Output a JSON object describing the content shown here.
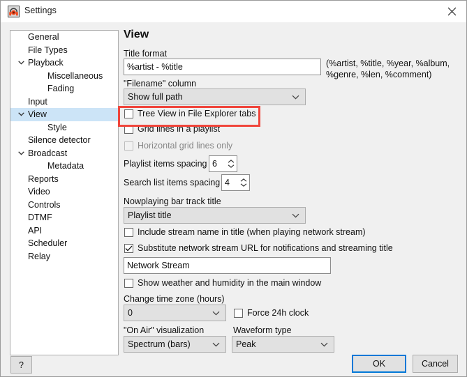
{
  "window": {
    "title": "Settings",
    "app_icon": "headphones-icon",
    "close_icon": "close-icon"
  },
  "sidebar": {
    "items": [
      {
        "label": "General",
        "level": 0,
        "chevron": false,
        "selected": false
      },
      {
        "label": "File Types",
        "level": 0,
        "chevron": false,
        "selected": false
      },
      {
        "label": "Playback",
        "level": 0,
        "chevron": true,
        "selected": false
      },
      {
        "label": "Miscellaneous",
        "level": 1,
        "chevron": false,
        "selected": false
      },
      {
        "label": "Fading",
        "level": 1,
        "chevron": false,
        "selected": false
      },
      {
        "label": "Input",
        "level": 0,
        "chevron": false,
        "selected": false
      },
      {
        "label": "View",
        "level": 0,
        "chevron": true,
        "selected": true
      },
      {
        "label": "Style",
        "level": 1,
        "chevron": false,
        "selected": false
      },
      {
        "label": "Silence detector",
        "level": 0,
        "chevron": false,
        "selected": false
      },
      {
        "label": "Broadcast",
        "level": 0,
        "chevron": true,
        "selected": false
      },
      {
        "label": "Metadata",
        "level": 1,
        "chevron": false,
        "selected": false
      },
      {
        "label": "Reports",
        "level": 0,
        "chevron": false,
        "selected": false
      },
      {
        "label": "Video",
        "level": 0,
        "chevron": false,
        "selected": false
      },
      {
        "label": "Controls",
        "level": 0,
        "chevron": false,
        "selected": false
      },
      {
        "label": "DTMF",
        "level": 0,
        "chevron": false,
        "selected": false
      },
      {
        "label": "API",
        "level": 0,
        "chevron": false,
        "selected": false
      },
      {
        "label": "Scheduler",
        "level": 0,
        "chevron": false,
        "selected": false
      },
      {
        "label": "Relay",
        "level": 0,
        "chevron": false,
        "selected": false
      }
    ]
  },
  "main": {
    "page_title": "View",
    "title_format_label": "Title format",
    "title_format_value": "%artist - %title",
    "title_format_hint_line1": "(%artist, %title, %year, %album,",
    "title_format_hint_line2": "%genre, %len, %comment)",
    "filename_column_label": "\"Filename\" column",
    "filename_column_value": "Show full path",
    "tree_view_label": "Tree View in File Explorer tabs",
    "tree_view_checked": false,
    "grid_lines_label": "Grid lines in a playlist",
    "grid_lines_checked": false,
    "horizontal_grid_label": "Horizontal grid lines only",
    "horizontal_grid_checked": false,
    "horizontal_grid_disabled": true,
    "playlist_spacing_label": "Playlist items spacing",
    "playlist_spacing_value": "6",
    "search_spacing_label": "Search list items spacing",
    "search_spacing_value": "4",
    "nowplaying_label": "Nowplaying bar track title",
    "nowplaying_value": "Playlist title",
    "include_stream_label": "Include stream name in title (when playing network stream)",
    "include_stream_checked": false,
    "substitute_label": "Substitute network stream URL for notifications and streaming title",
    "substitute_checked": true,
    "network_stream_value": "Network Stream",
    "weather_label": "Show weather and humidity in the main window",
    "weather_checked": false,
    "timezone_label": "Change time zone (hours)",
    "timezone_value": "0",
    "force24_label": "Force 24h clock",
    "force24_checked": false,
    "onair_label": "\"On Air\" visualization",
    "onair_value": "Spectrum (bars)",
    "waveform_label": "Waveform type",
    "waveform_value": "Peak"
  },
  "footer": {
    "help_label": "?",
    "ok_label": "OK",
    "cancel_label": "Cancel"
  },
  "annotation": {
    "highlight_color": "#f0463c",
    "highlight_target": "tree-view-checkbox-row"
  }
}
